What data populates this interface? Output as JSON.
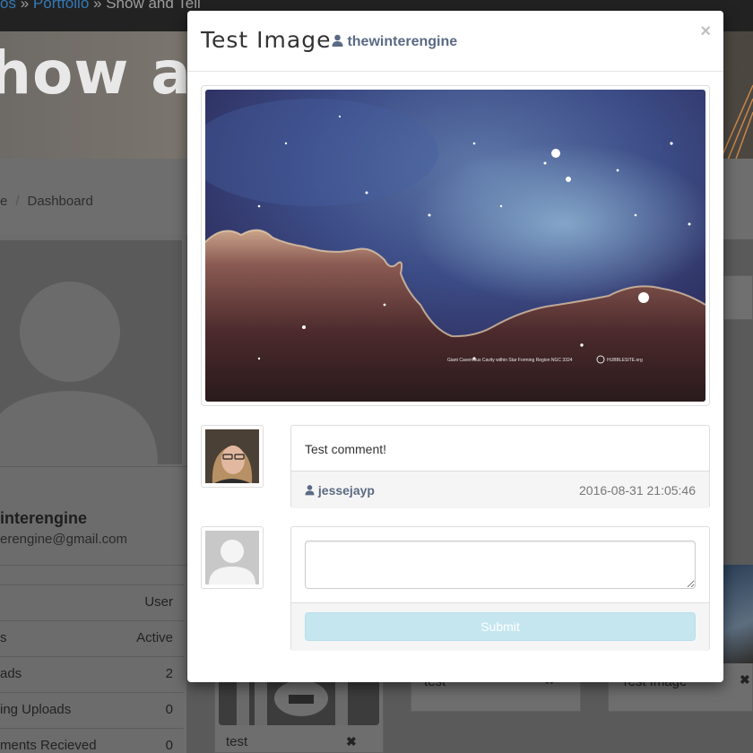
{
  "background": {
    "nav": {
      "crumb_first": "os",
      "crumb_portfolio": "Portfolio",
      "crumb_current": "Show and Tell",
      "separator": "»"
    },
    "hero_title": "how an",
    "breadcrumb": {
      "home": "e",
      "separator": "/",
      "current": "Dashboard"
    },
    "profile": {
      "name": "interengine",
      "email": "erengine@gmail.com",
      "stats": [
        {
          "label": "",
          "value": "User"
        },
        {
          "label": "s",
          "value": "Active"
        },
        {
          "label": "ads",
          "value": "2"
        },
        {
          "label": "ing Uploads",
          "value": "0"
        },
        {
          "label": "ments Recieved",
          "value": "0"
        }
      ]
    },
    "gallery": [
      {
        "caption": "test"
      },
      {
        "caption": "test"
      },
      {
        "caption": "Test Image"
      }
    ],
    "remove_glyph": "✖"
  },
  "modal": {
    "title": "Test Image",
    "owner": "thewinterengine",
    "close_label": "×",
    "image": {
      "caption": "Giant Cavernous Cavity within Star Forming Region NGC 3324",
      "credit": "HUBBLESITE.org"
    },
    "comments": [
      {
        "text": "Test comment!",
        "author": "jessejayp",
        "timestamp": "2016-08-31 21:05:46"
      }
    ],
    "new_comment": {
      "placeholder": "",
      "submit_label": "Submit"
    }
  },
  "colors": {
    "link": "#337ab7",
    "username": "#5b6a84",
    "submit_disabled": "#c5e6ef"
  }
}
